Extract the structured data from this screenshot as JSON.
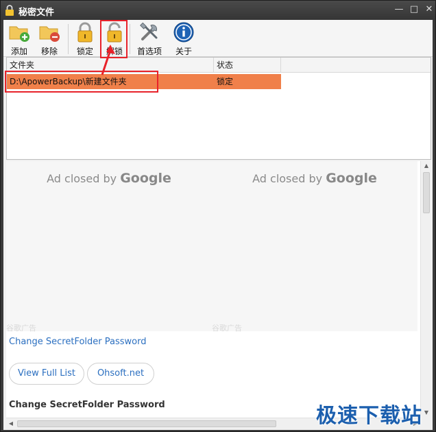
{
  "window": {
    "title": "秘密文件"
  },
  "colors": {
    "selected_row": "#f0804a",
    "annotation": "#e8222a",
    "link": "#2b6fc0",
    "watermark": "#1c5fae"
  },
  "toolbar": {
    "add": {
      "label": "添加",
      "icon": "folder-add-icon"
    },
    "remove": {
      "label": "移除",
      "icon": "folder-remove-icon"
    },
    "lock": {
      "label": "锁定",
      "icon": "lock-icon"
    },
    "unlock": {
      "label": "解锁",
      "icon": "unlock-icon"
    },
    "preferences": {
      "label": "首选项",
      "icon": "tools-icon"
    },
    "about": {
      "label": "关于",
      "icon": "info-icon"
    }
  },
  "list": {
    "columns": [
      "文件夹",
      "状态"
    ],
    "rows": [
      {
        "folder": "D:\\ApowerBackup\\新建文件夹",
        "status": "锁定"
      }
    ]
  },
  "web": {
    "ad_left": {
      "prefix": "Ad closed by",
      "brand": "Google",
      "tag": "谷歌广告"
    },
    "ad_right": {
      "prefix": "Ad closed by",
      "brand": "Google",
      "tag": "谷歌广告"
    },
    "link_change_password": "Change SecretFolder Password",
    "buttons": [
      "View Full List",
      "Ohsoft.net"
    ],
    "heading": "Change SecretFolder Password"
  },
  "watermark": "极速下载站"
}
